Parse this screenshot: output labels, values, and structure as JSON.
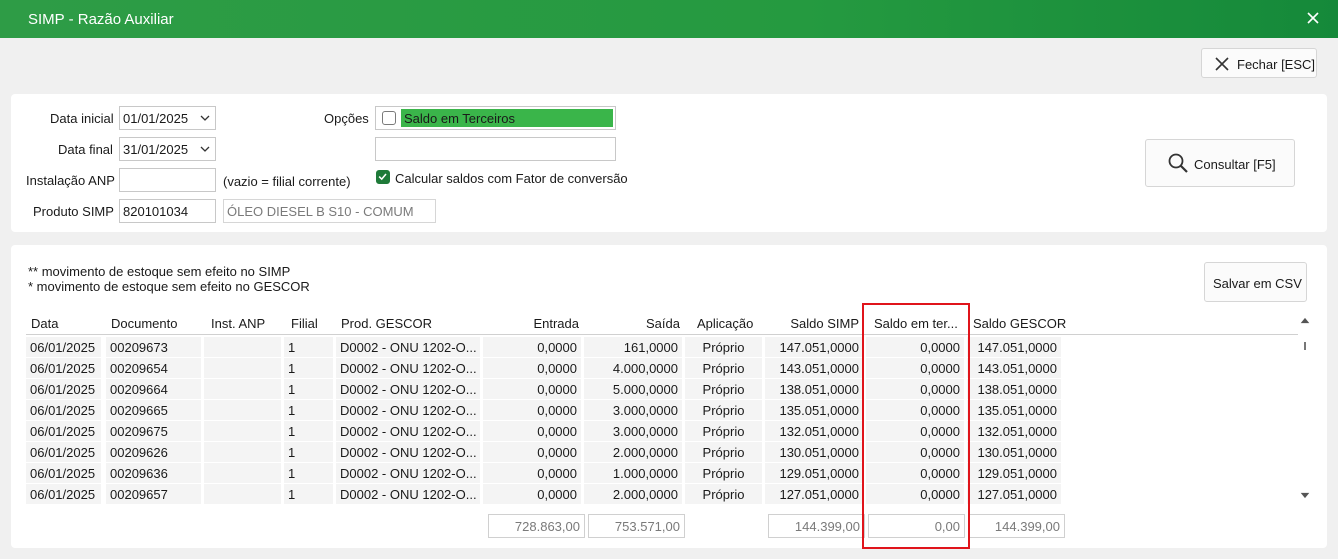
{
  "window": {
    "title": "SIMP - Razão Auxiliar"
  },
  "toolbar": {
    "close_label": "Fechar [ESC]"
  },
  "form": {
    "data_inicial_label": "Data inicial",
    "data_inicial_value": "01/01/2025",
    "data_final_label": "Data final",
    "data_final_value": "31/01/2025",
    "instalacao_label": "Instalação ANP",
    "instalacao_value": "",
    "instalacao_hint": "(vazio = filial corrente)",
    "produto_label": "Produto SIMP",
    "produto_code": "820101034",
    "produto_desc": "ÓLEO DIESEL B S10 - COMUM",
    "opcoes_label": "Opções",
    "saldo_terceiros_label": "Saldo em Terceiros",
    "saldo_terceiros_checked": false,
    "opcoes_value2": "",
    "fator_label": "Calcular saldos com Fator de conversão",
    "fator_checked": true,
    "consultar_label": "Consultar [F5]"
  },
  "notes": {
    "line1": "** movimento de estoque sem efeito no SIMP",
    "line2": "* movimento de estoque sem efeito no GESCOR"
  },
  "csv_label": "Salvar em CSV",
  "table": {
    "headers": {
      "data": "Data",
      "documento": "Documento",
      "inst": "Inst. ANP",
      "filial": "Filial",
      "prod": "Prod. GESCOR",
      "entrada": "Entrada",
      "saida": "Saída",
      "aplicacao": "Aplicação",
      "saldo_simp": "Saldo SIMP",
      "saldo_terceiros": "Saldo em ter...",
      "saldo_gescor": "Saldo GESCOR"
    },
    "rows": [
      {
        "data": "06/01/2025",
        "documento": "00209673",
        "inst": "",
        "filial": "1",
        "prod": "D0002 - ONU 1202-O...",
        "entrada": "0,0000",
        "saida": "161,0000",
        "aplicacao": "Próprio",
        "saldo_simp": "147.051,0000",
        "saldo_terceiros": "0,0000",
        "saldo_gescor": "147.051,0000"
      },
      {
        "data": "06/01/2025",
        "documento": "00209654",
        "inst": "",
        "filial": "1",
        "prod": "D0002 - ONU 1202-O...",
        "entrada": "0,0000",
        "saida": "4.000,0000",
        "aplicacao": "Próprio",
        "saldo_simp": "143.051,0000",
        "saldo_terceiros": "0,0000",
        "saldo_gescor": "143.051,0000"
      },
      {
        "data": "06/01/2025",
        "documento": "00209664",
        "inst": "",
        "filial": "1",
        "prod": "D0002 - ONU 1202-O...",
        "entrada": "0,0000",
        "saida": "5.000,0000",
        "aplicacao": "Próprio",
        "saldo_simp": "138.051,0000",
        "saldo_terceiros": "0,0000",
        "saldo_gescor": "138.051,0000"
      },
      {
        "data": "06/01/2025",
        "documento": "00209665",
        "inst": "",
        "filial": "1",
        "prod": "D0002 - ONU 1202-O...",
        "entrada": "0,0000",
        "saida": "3.000,0000",
        "aplicacao": "Próprio",
        "saldo_simp": "135.051,0000",
        "saldo_terceiros": "0,0000",
        "saldo_gescor": "135.051,0000"
      },
      {
        "data": "06/01/2025",
        "documento": "00209675",
        "inst": "",
        "filial": "1",
        "prod": "D0002 - ONU 1202-O...",
        "entrada": "0,0000",
        "saida": "3.000,0000",
        "aplicacao": "Próprio",
        "saldo_simp": "132.051,0000",
        "saldo_terceiros": "0,0000",
        "saldo_gescor": "132.051,0000"
      },
      {
        "data": "06/01/2025",
        "documento": "00209626",
        "inst": "",
        "filial": "1",
        "prod": "D0002 - ONU 1202-O...",
        "entrada": "0,0000",
        "saida": "2.000,0000",
        "aplicacao": "Próprio",
        "saldo_simp": "130.051,0000",
        "saldo_terceiros": "0,0000",
        "saldo_gescor": "130.051,0000"
      },
      {
        "data": "06/01/2025",
        "documento": "00209636",
        "inst": "",
        "filial": "1",
        "prod": "D0002 - ONU 1202-O...",
        "entrada": "0,0000",
        "saida": "1.000,0000",
        "aplicacao": "Próprio",
        "saldo_simp": "129.051,0000",
        "saldo_terceiros": "0,0000",
        "saldo_gescor": "129.051,0000"
      },
      {
        "data": "06/01/2025",
        "documento": "00209657",
        "inst": "",
        "filial": "1",
        "prod": "D0002 - ONU 1202-O...",
        "entrada": "0,0000",
        "saida": "2.000,0000",
        "aplicacao": "Próprio",
        "saldo_simp": "127.051,0000",
        "saldo_terceiros": "0,0000",
        "saldo_gescor": "127.051,0000"
      }
    ]
  },
  "totals": {
    "entrada": "728.863,00",
    "saida": "753.571,00",
    "saldo_simp": "144.399,00",
    "saldo_terceiros": "0,00",
    "saldo_gescor": "144.399,00"
  },
  "colors": {
    "title_bar": "#259a40",
    "option_highlight": "#3ab54a",
    "check_accent": "#1f7a39",
    "annotation_box": "#e0141b"
  }
}
